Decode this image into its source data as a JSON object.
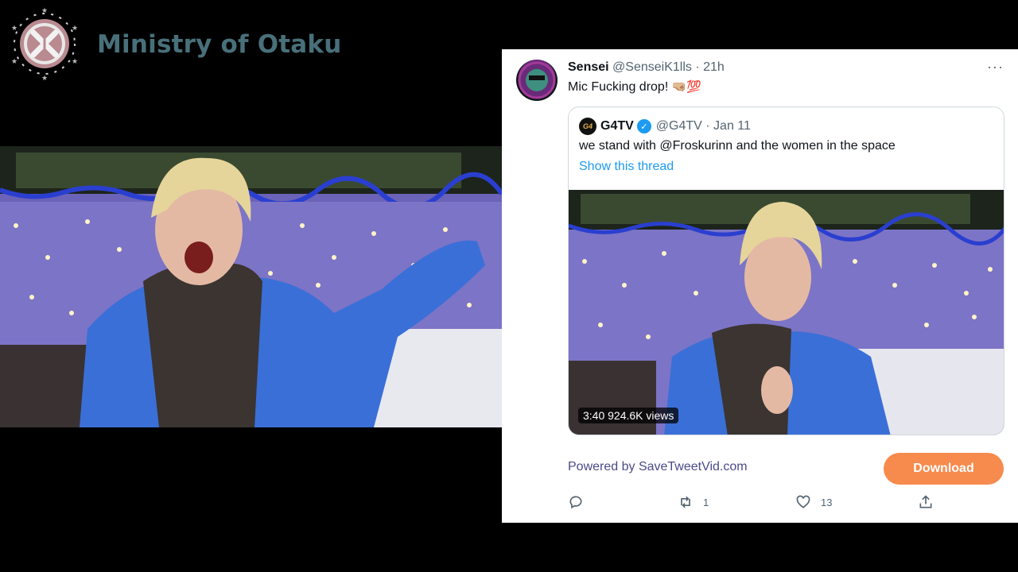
{
  "channel": {
    "name": "Ministry of Otaku"
  },
  "tweet": {
    "author_name": "Sensei",
    "author_meta": "@SenseiK1lls · 21h",
    "more": "···",
    "text": "Mic Fucking drop!",
    "emoji": "🤜🏼💯"
  },
  "quote": {
    "avatar_text": "G4",
    "author_name": "G4TV",
    "verified_mark": "✓",
    "author_meta": "@G4TV · Jan 11",
    "text": "we stand with @Froskurinn and the women in the space",
    "show_thread": "Show this thread",
    "video_badge": "3:40  924.6K views"
  },
  "footer": {
    "powered_by": "Powered by SaveTweetVid.com",
    "download_label": "Download"
  },
  "actions": {
    "reply_icon": "reply-icon",
    "retweet_icon": "retweet-icon",
    "retweet_count": "1",
    "like_icon": "heart-icon",
    "like_count": "13",
    "share_icon": "share-icon"
  },
  "colors": {
    "brand_text": "#49707a",
    "link": "#1d9bf0",
    "download_button": "#f78a4d",
    "jacket_blue": "#3a6fd8",
    "lights_purple": "#6c5fd0"
  }
}
